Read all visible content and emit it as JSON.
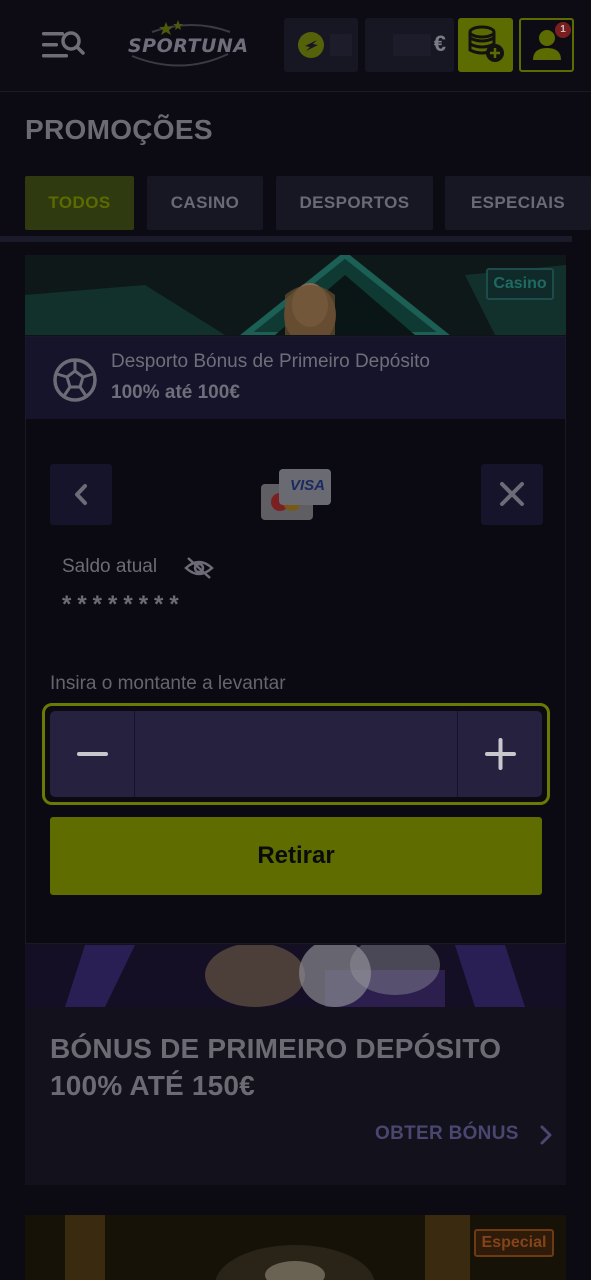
{
  "header": {
    "logo_text": "SPORTUNA",
    "balance_currency": "€",
    "notification_count": "1"
  },
  "page": {
    "title": "PROMOÇÕES"
  },
  "tabs": [
    {
      "label": "TODOS",
      "active": true
    },
    {
      "label": "CASINO",
      "active": false
    },
    {
      "label": "DESPORTOS",
      "active": false
    },
    {
      "label": "ESPECIAIS",
      "active": false
    }
  ],
  "promo1": {
    "badge": "Casino"
  },
  "modal": {
    "title": "Desporto Bónus de Primeiro Depósito",
    "subtitle": "100% até 100€",
    "card_brand": "VISA",
    "balance_label": "Saldo atual",
    "balance_masked": "********",
    "amount_label": "Insira o montante a levantar",
    "amount_value": "",
    "withdraw_label": "Retirar"
  },
  "promo2": {
    "headline_line1": "BÓNUS DE PRIMEIRO DEPÓSITO",
    "headline_line2": "100% ATÉ 150€",
    "cta": "OBTER BÓNUS"
  },
  "promo3": {
    "badge": "Especial"
  },
  "colors": {
    "accent": "#c6e000",
    "background": "#0c0b14",
    "panel": "#15142a"
  }
}
